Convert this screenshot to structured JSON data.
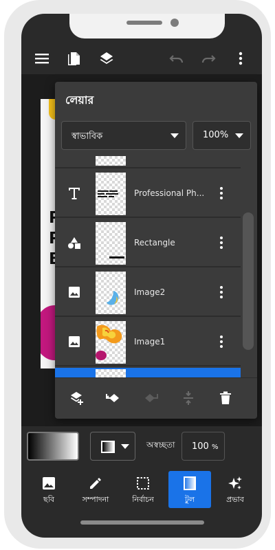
{
  "colors": {
    "accent": "#1a73e8",
    "panel": "#3b3b3b",
    "background": "#2a2a2a"
  },
  "toolbar": {
    "icons": [
      "menu-icon",
      "pages-icon",
      "layers-icon",
      "undo-icon",
      "redo-icon",
      "more-vert-icon"
    ]
  },
  "artboard": {
    "lines": [
      "P",
      "P",
      "B"
    ]
  },
  "layers_panel": {
    "title": "লেয়ার",
    "blend_mode": "স্বাভাবিক",
    "opacity": "100%",
    "layers": [
      {
        "type_icon": "text-icon",
        "name": "Professional Ph..."
      },
      {
        "type_icon": "shapes-icon",
        "name": "Rectangle"
      },
      {
        "type_icon": "image-icon",
        "name": "Image2"
      },
      {
        "type_icon": "image-icon",
        "name": "Image1"
      }
    ],
    "actions": [
      "add-layer-icon",
      "move-layer-icon",
      "merge-layer-icon",
      "align-layer-icon",
      "delete-icon"
    ]
  },
  "properties": {
    "opacity_label": "অস্বচ্ছতা",
    "opacity_value": "100",
    "opacity_unit": "%"
  },
  "bottom_nav": [
    {
      "icon": "image-icon",
      "label": "ছবি",
      "active": false
    },
    {
      "icon": "pencil-icon",
      "label": "সম্পাদনা",
      "active": false
    },
    {
      "icon": "selection-icon",
      "label": "নির্বাচন",
      "active": false
    },
    {
      "icon": "gradient-tool-icon",
      "label": "টুল",
      "active": true
    },
    {
      "icon": "sparkles-icon",
      "label": "প্রভাব",
      "active": false
    }
  ]
}
